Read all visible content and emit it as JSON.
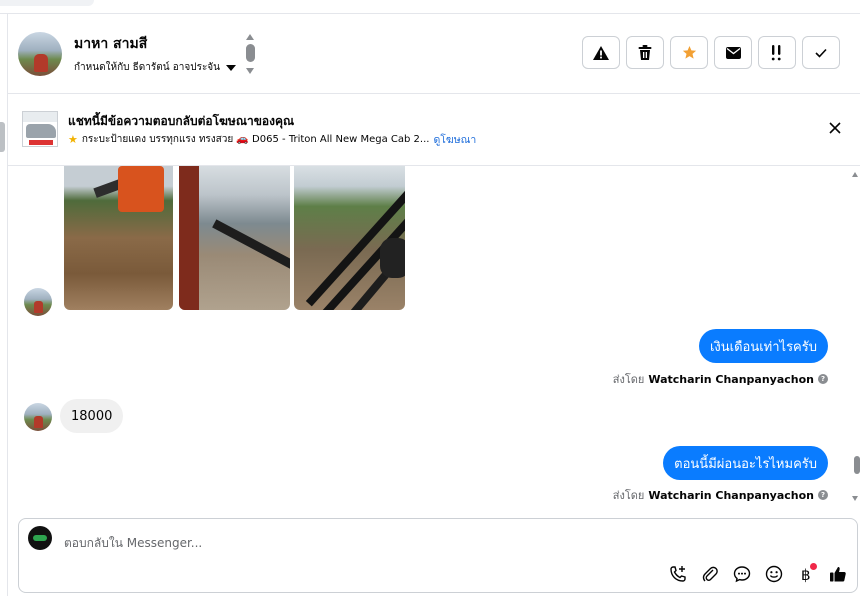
{
  "header": {
    "contact_name": "มาหา สามสี",
    "assigned_label": "กำหนดให้กับ ธีดารัตน์ อาจประจัน",
    "actions": [
      {
        "name": "mark-spam-button",
        "icon": "warning-icon"
      },
      {
        "name": "delete-button",
        "icon": "trash-icon"
      },
      {
        "name": "star-button",
        "icon": "star-icon"
      },
      {
        "name": "mark-unread-button",
        "icon": "envelope-icon"
      },
      {
        "name": "follow-up-button",
        "icon": "follow-up-icon"
      },
      {
        "name": "mark-done-button",
        "icon": "check-icon"
      }
    ]
  },
  "ad_banner": {
    "title": "แชทนี้มีข้อความตอบกลับต่อโฆษณาของคุณ",
    "detail": "กระบะป้ายแดง บรรทุกแรง ทรงสวย 🚗 D065 - Triton All New Mega Cab 2...",
    "link_label": "ดูโฆษณา"
  },
  "thread": {
    "messages": [
      {
        "direction": "in",
        "type": "photos",
        "count": 3
      },
      {
        "direction": "out",
        "text": "เงินเดือนเท่าไรครับ",
        "sent_by_prefix": "ส่งโดย",
        "sent_by_name": "Watcharin Chanpanyachon"
      },
      {
        "direction": "in",
        "text": "18000"
      },
      {
        "direction": "out",
        "text": "ตอนนี้มีผ่อนอะไรไหมครับ",
        "sent_by_prefix": "ส่งโดย",
        "sent_by_name": "Watcharin Chanpanyachon"
      }
    ]
  },
  "composer": {
    "placeholder": "ตอบกลับใน Messenger...",
    "tools": [
      "add-call-icon",
      "attachment-icon",
      "saved-reply-icon",
      "emoji-icon",
      "payment-icon",
      "thumbs-up-icon"
    ]
  },
  "colors": {
    "outgoing_bubble": "#0a7cff",
    "incoming_bubble": "#f0f0f0",
    "link": "#216fdb",
    "star": "#f2a033"
  }
}
